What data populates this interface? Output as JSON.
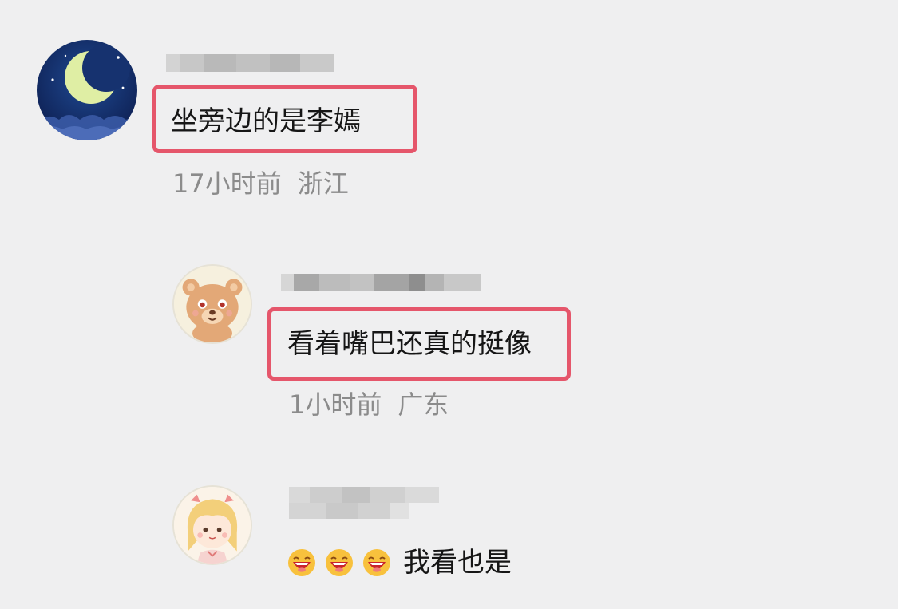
{
  "comments": [
    {
      "avatar": "moon-night-avatar",
      "text": "坐旁边的是李嫣",
      "time": "17小时前",
      "location": "浙江"
    },
    {
      "avatar": "bear-avatar",
      "text": "看着嘴巴还真的挺像",
      "time": "1小时前",
      "location": "广东"
    },
    {
      "avatar": "anime-girl-avatar",
      "emoji": [
        "laughing-emoji",
        "laughing-emoji",
        "laughing-emoji"
      ],
      "text": "我看也是"
    }
  ],
  "colors": {
    "background": "#efeff0",
    "highlight": "#e5566b",
    "meta_text": "#8b8b8b"
  }
}
